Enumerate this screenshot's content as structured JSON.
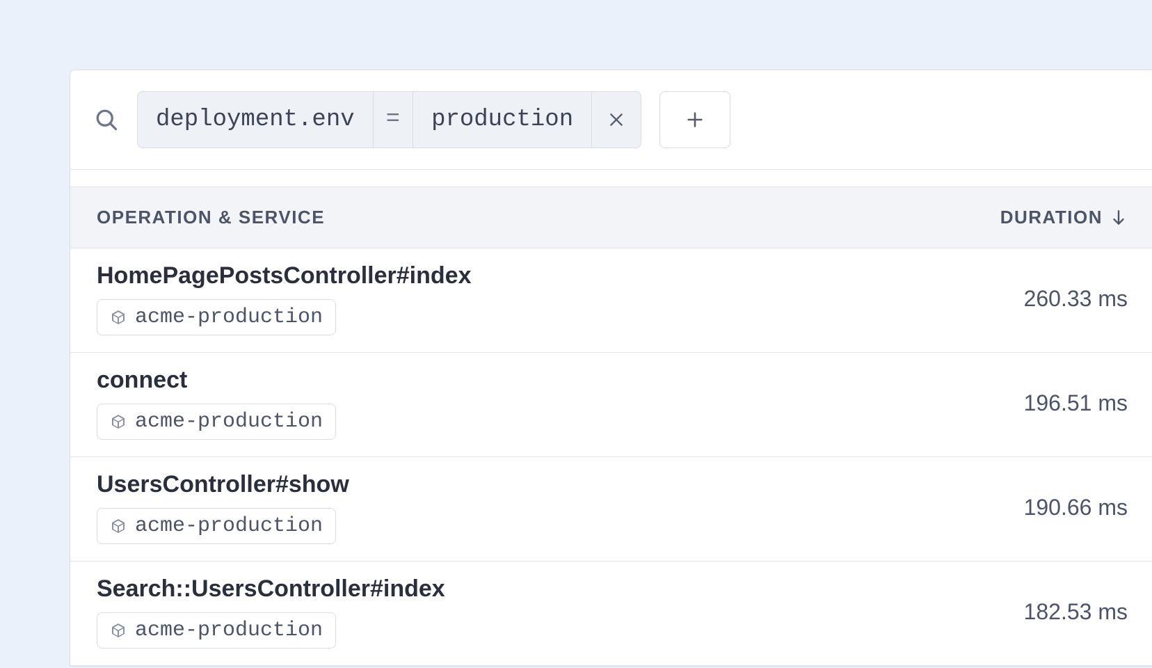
{
  "filter": {
    "key": "deployment.env",
    "operator": "=",
    "value": "production"
  },
  "columns": {
    "left": "OPERATION & SERVICE",
    "right": "DURATION",
    "sort": "desc"
  },
  "rows": [
    {
      "operation": "HomePagePostsController#index",
      "service": "acme-production",
      "duration": "260.33 ms"
    },
    {
      "operation": "connect",
      "service": "acme-production",
      "duration": "196.51 ms"
    },
    {
      "operation": "UsersController#show",
      "service": "acme-production",
      "duration": "190.66 ms"
    },
    {
      "operation": "Search::UsersController#index",
      "service": "acme-production",
      "duration": "182.53 ms"
    }
  ]
}
